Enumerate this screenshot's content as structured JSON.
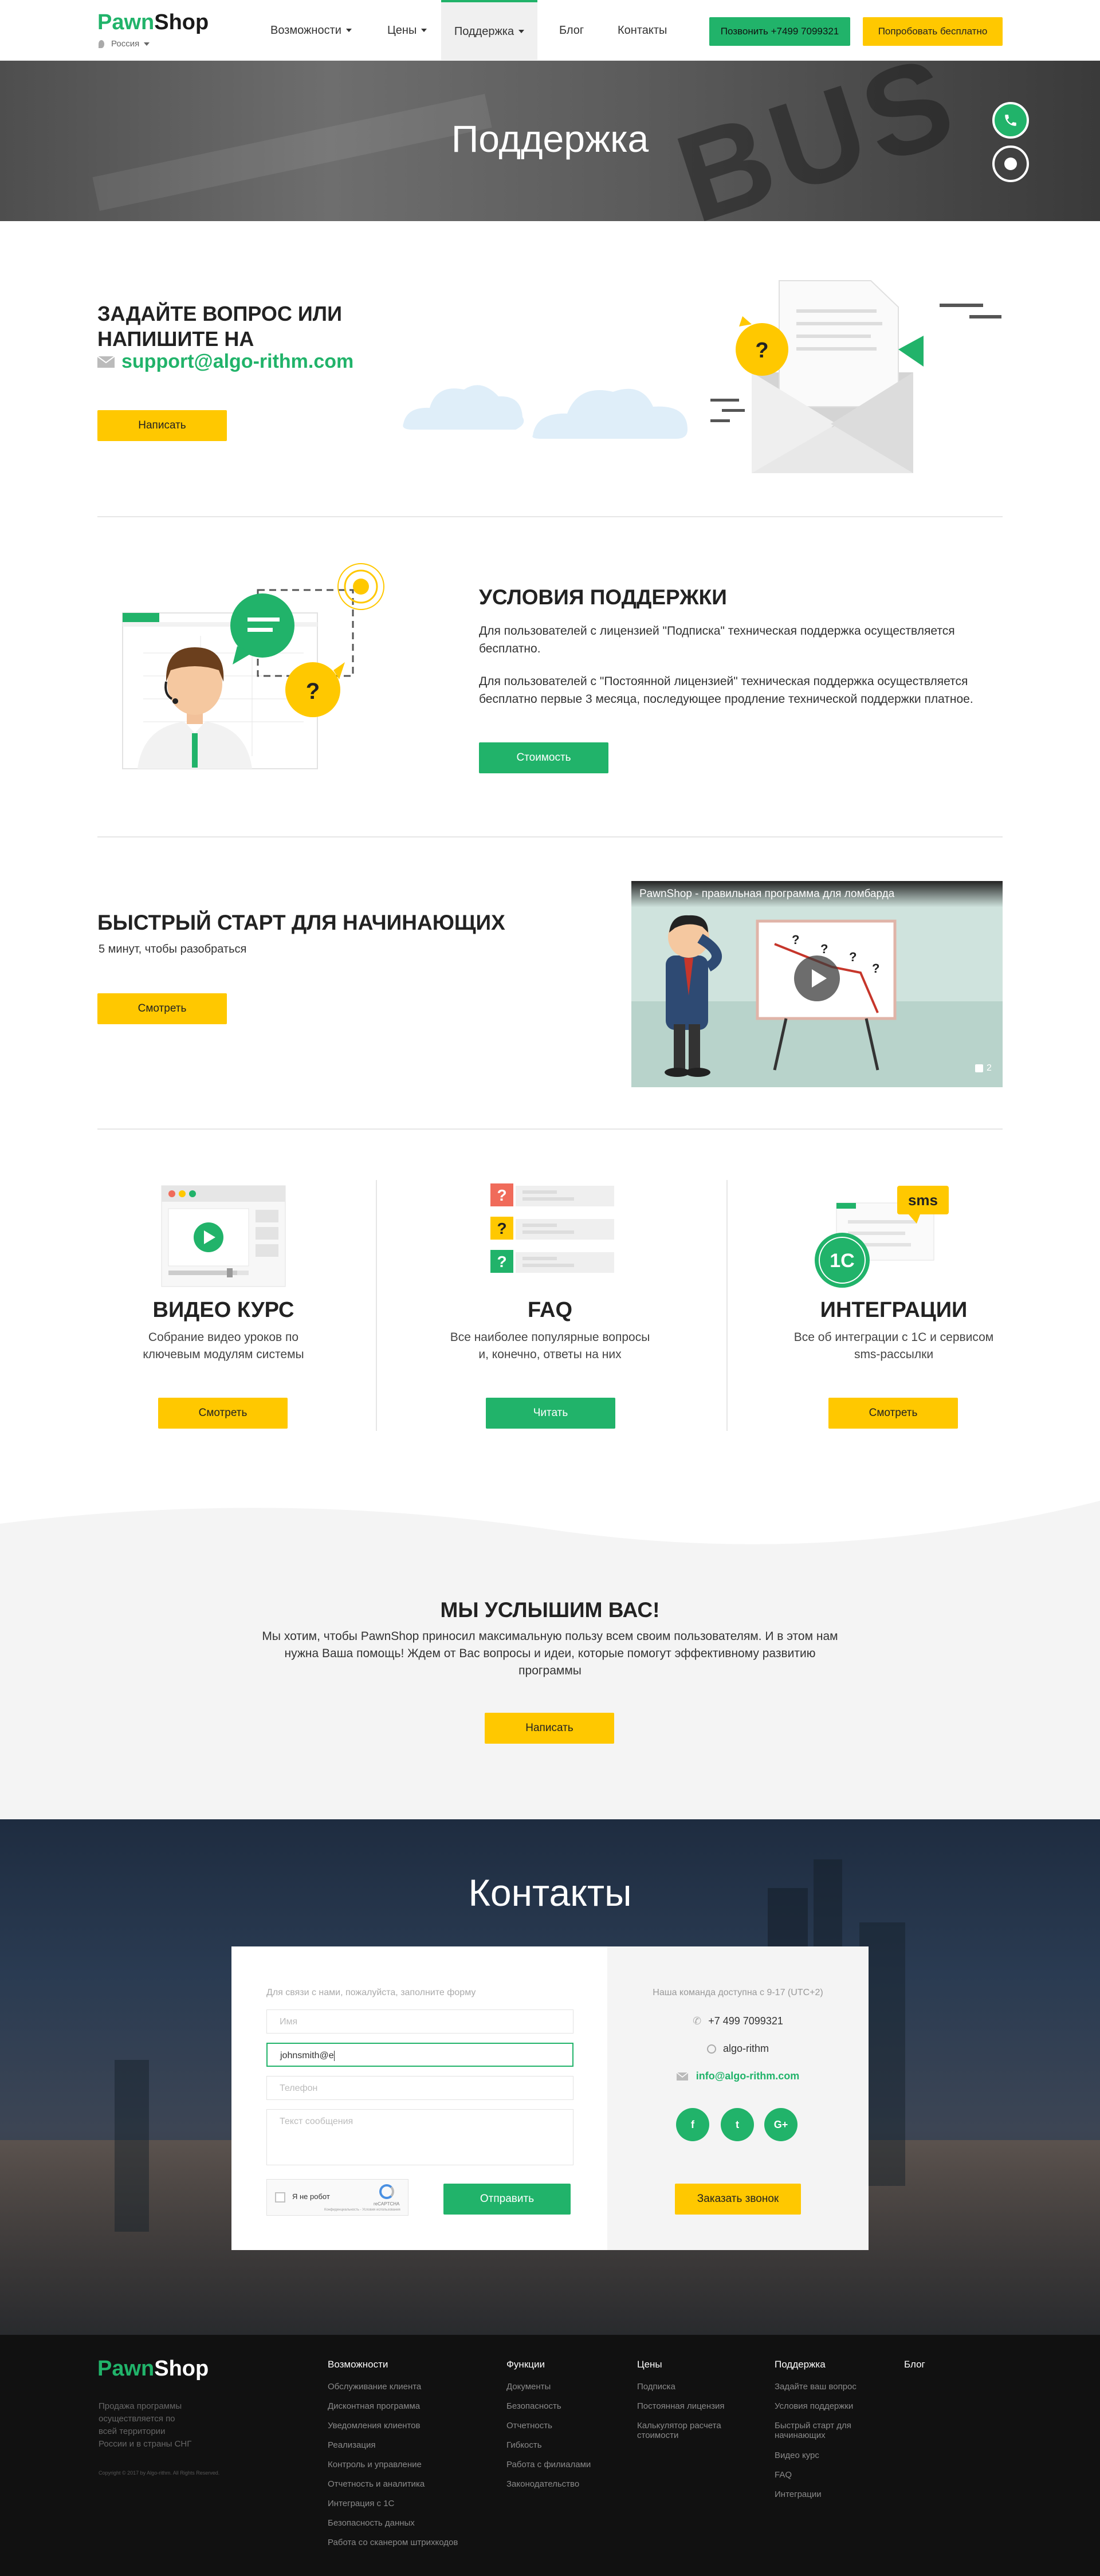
{
  "header": {
    "logo_pawn": "Pawn",
    "logo_shop": "Shop",
    "region": "Россия",
    "nav": [
      "Возможности",
      "Цены",
      "Поддержка",
      "Блог",
      "Контакты"
    ],
    "call_button": "Позвонить +7499 7099321",
    "try_button": "Попробовать бесплатно"
  },
  "hero": {
    "title": "Поддержка"
  },
  "ask": {
    "title_line1": "ЗАДАЙТЕ ВОПРОС ИЛИ",
    "title_line2": "НАПИШИТЕ НА",
    "email": "support@algo-rithm.com",
    "button": "Написать"
  },
  "terms": {
    "title": "УСЛОВИЯ ПОДДЕРЖКИ",
    "p1": "Для пользователей с лицензией \"Подписка\" техническая поддержка осуществляется бесплатно.",
    "p2": "Для пользователей с \"Постоянной лицензией\" техническая поддержка осуществляется бесплатно первые 3 месяца, последующее продление технической поддержки платное.",
    "button": "Стоимость"
  },
  "quickstart": {
    "title": "БЫСТРЫЙ СТАРТ ДЛЯ НАЧИНАЮЩИХ",
    "subtitle": "5 минут, чтобы разобраться",
    "button": "Смотреть",
    "video_title": "PawnShop - правильная программа для ломбарда",
    "likes": "2"
  },
  "cards": [
    {
      "title": "ВИДЕО КУРС",
      "text1": "Собрание видео уроков по",
      "text2": "ключевым модулям системы",
      "button": "Смотреть"
    },
    {
      "title": "FAQ",
      "text1": "Все наиболее популярные вопросы",
      "text2": "и, конечно, ответы на них",
      "button": "Читать"
    },
    {
      "title": "ИНТЕГРАЦИИ",
      "text1": "Все об интеграции с 1С и сервисом",
      "text2": "sms-рассылки",
      "button": "Смотреть"
    }
  ],
  "hear": {
    "title": "МЫ УСЛЫШИМ ВАС!",
    "line1": "Мы хотим, чтобы PawnShop приносил максимальную пользу всем своим пользователям. И в этом нам",
    "line2": "нужна Ваша помощь! Ждем от Вас вопросы и идеи, которые помогут эффективному развитию",
    "line3": "программы",
    "button": "Написать"
  },
  "contacts": {
    "title": "Контакты",
    "form_hint": "Для связи с нами, пожалуйста, заполните форму",
    "name_placeholder": "Имя",
    "email_value": "johnsmith@e",
    "phone_placeholder": "Телефон",
    "message_placeholder": "Текст сообщения",
    "captcha_label": "Я не робот",
    "captcha_brand": "reCAPTCHA",
    "captcha_terms": "Конфиденциальность - Условия использования",
    "send_button": "Отправить",
    "availability": "Наша команда доступна с 9-17 (UTC+2)",
    "phone": "+7 499 7099321",
    "skype": "algo-rithm",
    "email": "info@algo-rithm.com",
    "social": [
      "f",
      "t",
      "G+"
    ],
    "callback_button": "Заказать звонок"
  },
  "footer": {
    "about": [
      "Продажа программы",
      "осуществляется по",
      "всей территории",
      "России и в страны СНГ"
    ],
    "copyright": "Copyright © 2017 by Algo-rithm. All Rights Reserved.",
    "col1": {
      "title": "Возможности",
      "links": [
        "Обслуживание клиента",
        "Дисконтная программа",
        "Уведомления клиентов",
        "Реализация",
        "Контроль и управление",
        "Отчетность и аналитика",
        "Интеграция с 1С",
        "Безопасность данных",
        "Работа со сканером штрихкодов"
      ]
    },
    "col2": {
      "title": "Функции",
      "links": [
        "Документы",
        "Безопасность",
        "Отчетность",
        "Гибкость",
        "Работа с филиалами",
        "Законодательство"
      ]
    },
    "col3": {
      "title": "Цены",
      "links": [
        "Подписка",
        "Постоянная лицензия",
        "Калькулятор расчета",
        "стоимости"
      ]
    },
    "col4": {
      "title": "Поддержка",
      "links": [
        "Задайте ваш вопрос",
        "Условия поддержки",
        "Быстрый старт для",
        "начинающих",
        "Видео курс",
        "FAQ",
        "Интеграции"
      ]
    },
    "col5": {
      "title": "Блог"
    }
  },
  "colors": {
    "green": "#21b36a",
    "yellow": "#ffc800",
    "dark": "#111111"
  }
}
